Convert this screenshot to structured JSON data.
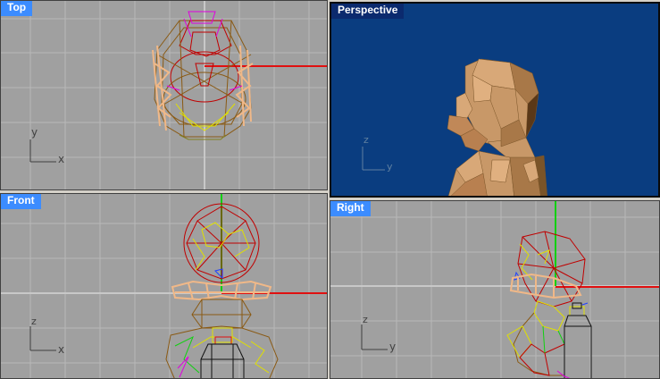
{
  "viewports": {
    "top": {
      "title": "Top",
      "axis_labels": {
        "vertical": "y",
        "horizontal": "x"
      }
    },
    "perspective": {
      "title": "Perspective",
      "axis_labels": {
        "vertical": "z",
        "horizontal": "y"
      }
    },
    "front": {
      "title": "Front",
      "axis_labels": {
        "vertical": "z",
        "horizontal": "x"
      }
    },
    "right": {
      "title": "Right",
      "axis_labels": {
        "vertical": "z",
        "horizontal": "y"
      }
    }
  },
  "colors": {
    "viewport_bg": "#a0a0a0",
    "perspective_bg": "#0a3d80",
    "grid": "#b8b8b8",
    "grid_major": "#c8c8c8",
    "inactive_title": "#3c8cff",
    "active_title": "#0b2a6e",
    "x_axis": "#e01010",
    "z_axis": "#10d010",
    "wire_red": "#c00000",
    "wire_brown": "#8a5a14",
    "wire_yellow": "#e0e000",
    "wire_peach": "#f0b888",
    "wire_magenta": "#e000e0",
    "wire_black": "#101010",
    "skin_light": "#d8a878",
    "skin_dark": "#a87848"
  }
}
